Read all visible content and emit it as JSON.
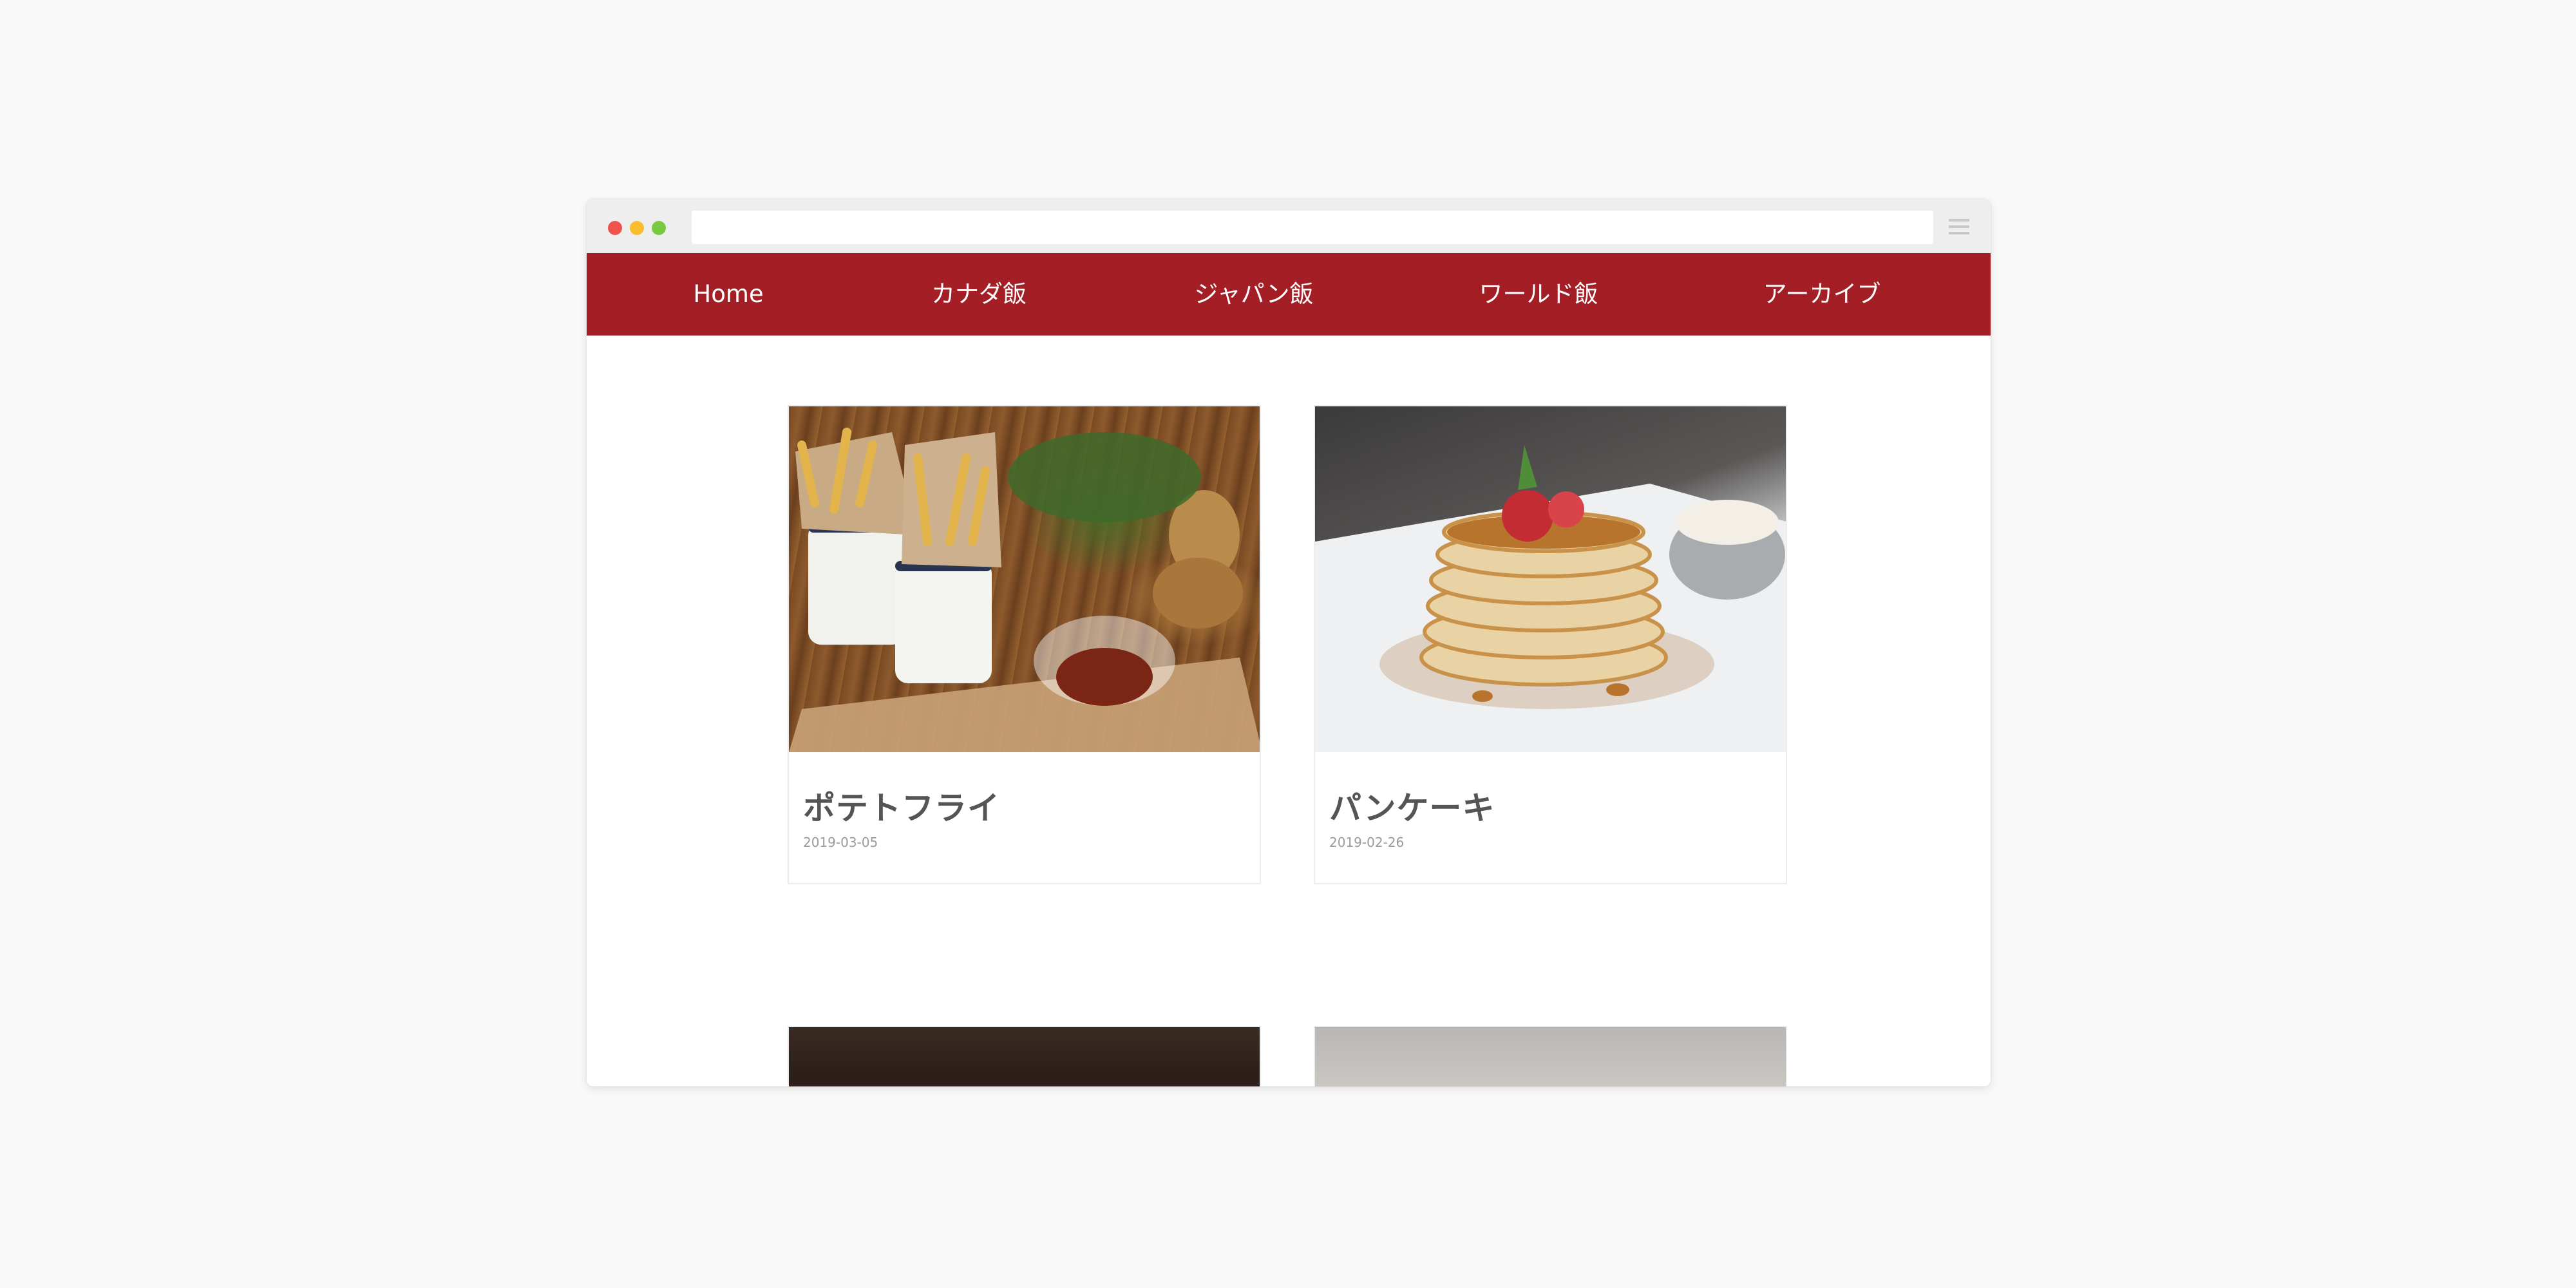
{
  "window": {
    "address": ""
  },
  "nav": {
    "items": [
      {
        "label": "Home"
      },
      {
        "label": "カナダ飯"
      },
      {
        "label": "ジャパン飯"
      },
      {
        "label": "ワールド飯"
      },
      {
        "label": "アーカイブ"
      }
    ]
  },
  "posts": [
    {
      "title": "ポテトフライ",
      "date": "2019-03-05",
      "image": "fries-photo"
    },
    {
      "title": "パンケーキ",
      "date": "2019-02-26",
      "image": "pancake-photo"
    },
    {
      "title": "",
      "date": "",
      "image": "partial-photo-dark"
    },
    {
      "title": "",
      "date": "",
      "image": "partial-photo-gray"
    }
  ],
  "colors": {
    "nav_background": "#a41f25",
    "page_background": "#f9f9f9",
    "title_text": "#555555",
    "date_text": "#9a9a9a"
  },
  "icons": {
    "window_controls": [
      "close-dot",
      "minimize-dot",
      "maximize-dot"
    ],
    "menu": "hamburger-menu-icon"
  }
}
